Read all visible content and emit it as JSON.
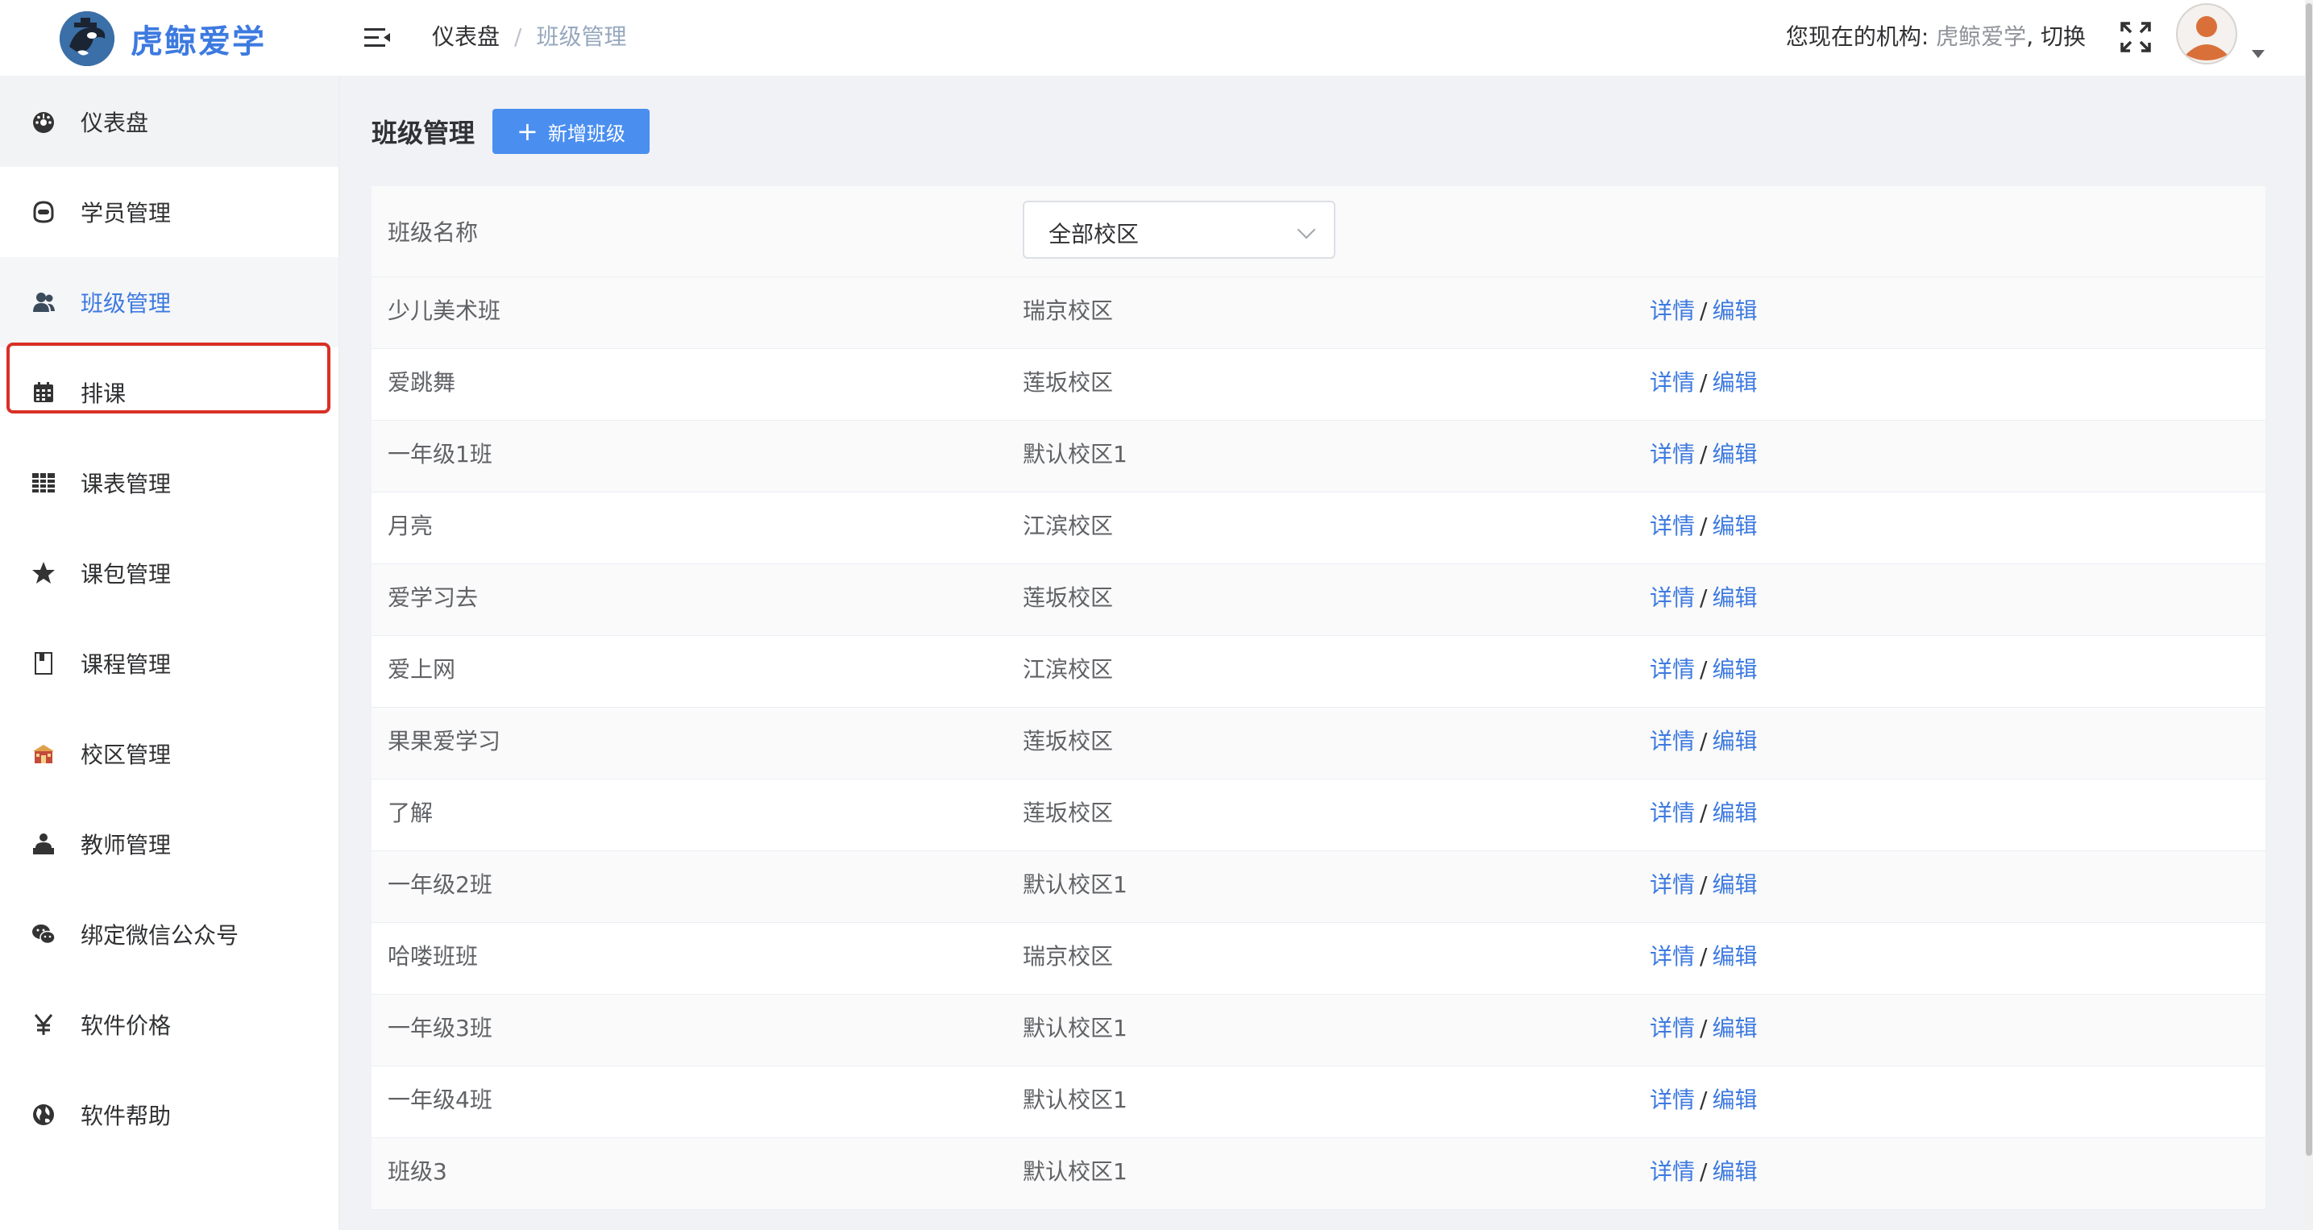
{
  "app": {
    "name": "虎鲸爱学"
  },
  "header": {
    "breadcrumb": [
      "仪表盘",
      "班级管理"
    ],
    "org_label": "您现在的机构:",
    "org_name": "虎鲸爱学",
    "org_switch": ", 切换"
  },
  "sidebar": {
    "items": [
      {
        "label": "仪表盘",
        "icon": "dashboard-icon"
      },
      {
        "label": "学员管理",
        "icon": "student-icon"
      },
      {
        "label": "班级管理",
        "icon": "users-icon"
      },
      {
        "label": "排课",
        "icon": "calendar-icon"
      },
      {
        "label": "课表管理",
        "icon": "table-icon"
      },
      {
        "label": "课包管理",
        "icon": "star-icon"
      },
      {
        "label": "课程管理",
        "icon": "book-icon"
      },
      {
        "label": "校区管理",
        "icon": "school-icon"
      },
      {
        "label": "教师管理",
        "icon": "teacher-icon"
      },
      {
        "label": "绑定微信公众号",
        "icon": "wechat-icon"
      },
      {
        "label": "软件价格",
        "icon": "yen-icon"
      },
      {
        "label": "软件帮助",
        "icon": "globe-icon"
      }
    ]
  },
  "main": {
    "title": "班级管理",
    "add_button": "新增班级",
    "table": {
      "col_name_header": "班级名称",
      "campus_filter": "全部校区",
      "detail_label": "详情",
      "edit_label": "编辑",
      "separator": "/",
      "rows": [
        {
          "name": "少儿美术班",
          "campus": "瑞京校区"
        },
        {
          "name": "爱跳舞",
          "campus": "莲坂校区"
        },
        {
          "name": "一年级1班",
          "campus": "默认校区1"
        },
        {
          "name": "月亮",
          "campus": "江滨校区"
        },
        {
          "name": "爱学习去",
          "campus": "莲坂校区"
        },
        {
          "name": "爱上网",
          "campus": "江滨校区"
        },
        {
          "name": "果果爱学习",
          "campus": "莲坂校区"
        },
        {
          "name": "了解",
          "campus": "莲坂校区"
        },
        {
          "name": "一年级2班",
          "campus": "默认校区1"
        },
        {
          "name": "哈喽班班",
          "campus": "瑞京校区"
        },
        {
          "name": "一年级3班",
          "campus": "默认校区1"
        },
        {
          "name": "一年级4班",
          "campus": "默认校区1"
        },
        {
          "name": "班级3",
          "campus": "默认校区1"
        }
      ]
    }
  },
  "colors": {
    "accent": "#3d7ae0",
    "button": "#4a8ef0",
    "highlight": "#d93025"
  }
}
